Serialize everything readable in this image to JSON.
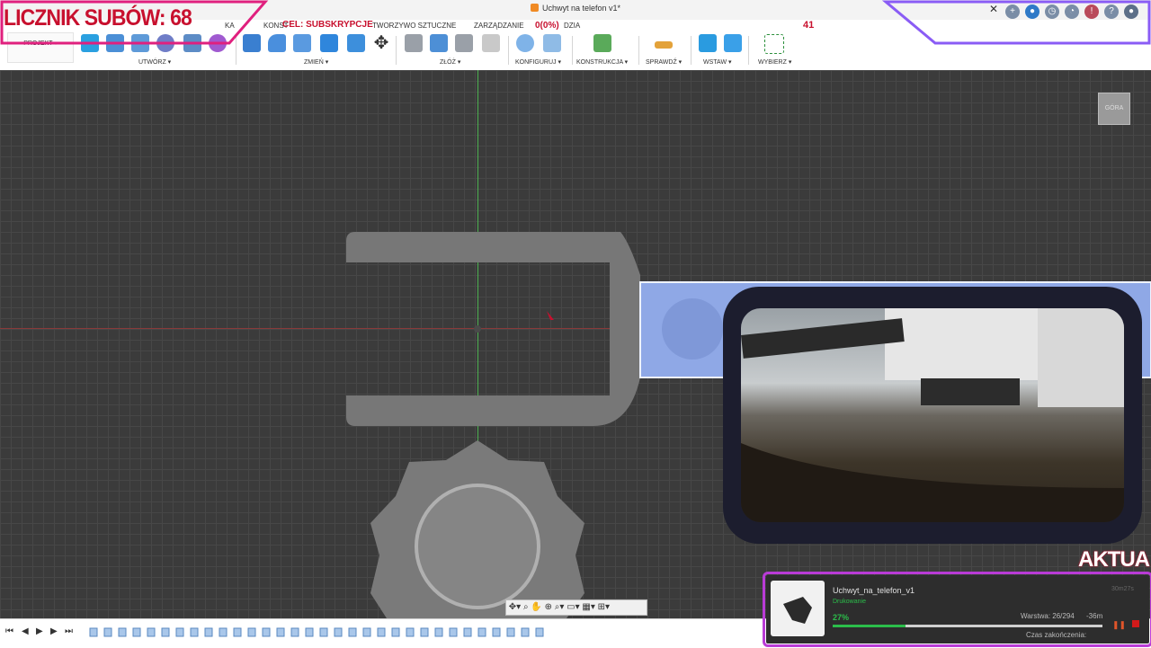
{
  "window": {
    "title": "Uchwyt na telefon v1*",
    "close_glyph": "✕"
  },
  "ribbon": {
    "tabs": [
      "KA",
      "KONST",
      "TWORZYWO SZTUCZNE",
      "ZARZĄDZANIE",
      "DZIA"
    ],
    "project_label": "PROJEKT ▾",
    "groups": [
      "UTWÓRZ ▾",
      "ZMIEŃ ▾",
      "ZŁÓŻ ▾",
      "KONFIGURUJ ▾",
      "KONSTRUKCJA ▾",
      "SPRAWDŹ ▾",
      "WSTAW ▾",
      "WYBIERZ ▾"
    ]
  },
  "viewcube": {
    "label": "GÓRA"
  },
  "overlay": {
    "subs_counter": "LICZNIK SUBÓW: 68",
    "goal_label": "CEL: SUBSKRYPCJE",
    "goal_progress": "0(0%)",
    "right_number": "41",
    "aktual": "AKTUA"
  },
  "printer": {
    "file_name": "Uchwyt_na_telefon_v1",
    "status": "Drukowanie",
    "percent": "27%",
    "progress": 0.27,
    "layer": "Warstwa: 26/294",
    "remaining": "-36m",
    "end_time_label": "Czas zakończenia:",
    "elapsed": "30m27s"
  },
  "colors": {
    "overlay_red": "#c8102e",
    "frame_gradient_start": "#e0207e",
    "frame_gradient_end": "#8a5cf5",
    "print_green": "#2bbd4a",
    "canvas_bg": "#3b3b3b",
    "selection_blue": "#8fa8e6"
  }
}
